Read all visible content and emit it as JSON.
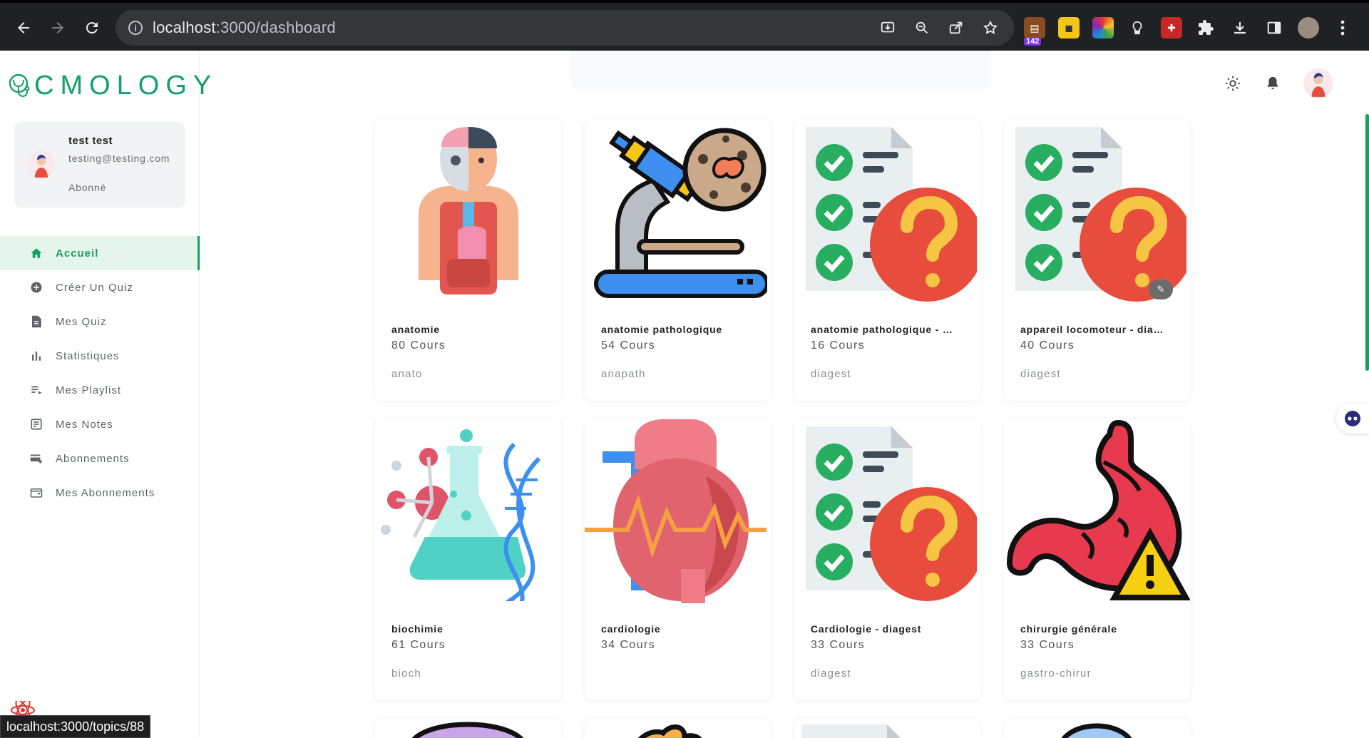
{
  "browser": {
    "url_host": "localhost",
    "url_path": ":3000/dashboard",
    "ext_badge": "142",
    "status_url": "localhost:3000/topics/88"
  },
  "brand": {
    "name": "CMOLOGY",
    "color": "#15a06a"
  },
  "profile": {
    "name": "test test",
    "email": "testing@testing.com",
    "status": "Abonné"
  },
  "menu": [
    {
      "label": "Accueil",
      "icon": "home-icon",
      "active": true
    },
    {
      "label": "Créer Un Quiz",
      "icon": "add-circle-icon"
    },
    {
      "label": "Mes Quiz",
      "icon": "document-icon"
    },
    {
      "label": "Statistiques",
      "icon": "bar-chart-icon"
    },
    {
      "label": "Mes Playlist",
      "icon": "playlist-icon"
    },
    {
      "label": "Mes Notes",
      "icon": "notes-icon"
    },
    {
      "label": "Abonnements",
      "icon": "card-add-icon"
    },
    {
      "label": "Mes Abonnements",
      "icon": "wallet-icon"
    }
  ],
  "topbar": {
    "icons": [
      "theme-toggle-icon",
      "notification-bell-icon",
      "user-avatar"
    ]
  },
  "cards": [
    {
      "title": "anatomie",
      "count": "80 Cours",
      "tag": "anato",
      "image": "anatomy-illustration"
    },
    {
      "title": "anatomie pathologique",
      "count": "54 Cours",
      "tag": "anapath",
      "image": "microscope-illustration"
    },
    {
      "title": "anatomie pathologique - …",
      "count": "16 Cours",
      "tag": "diagest",
      "image": "quiz-checklist-illustration"
    },
    {
      "title": "appareil locomoteur - dia…",
      "count": "40 Cours",
      "tag": "diagest",
      "image": "quiz-checklist-illustration"
    },
    {
      "title": "biochimie",
      "count": "61 Cours",
      "tag": "bioch",
      "image": "chemistry-flask-illustration"
    },
    {
      "title": "cardiologie",
      "count": "34 Cours",
      "tag": "",
      "image": "heart-illustration"
    },
    {
      "title": "Cardiologie - diagest",
      "count": "33 Cours",
      "tag": "diagest",
      "image": "quiz-checklist-illustration"
    },
    {
      "title": "chirurgie générale",
      "count": "33 Cours",
      "tag": "gastro-chirur",
      "image": "stomach-warning-illustration"
    }
  ],
  "colors": {
    "accent": "#17a05d",
    "active_bg": "#e6f5ec",
    "quiz_red": "#e74c3c",
    "check_green": "#27ae60"
  }
}
